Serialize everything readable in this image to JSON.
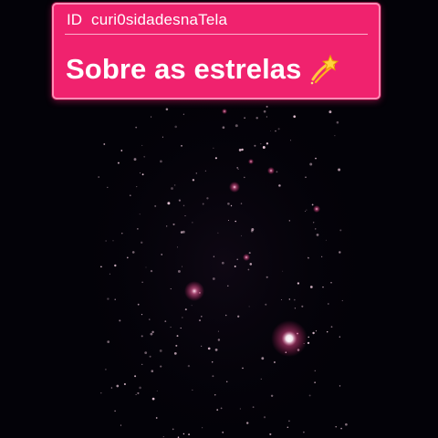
{
  "card": {
    "id_label": "ID",
    "id_handle": "curi0sidadesnaTela",
    "title": "Sobre as estrelas",
    "title_icon": "dizzy-star-icon",
    "accent": "#f0226e"
  },
  "scene": {
    "background": "#030208",
    "star_color": "#ffd9ec",
    "glow_color": "#ff4f98"
  }
}
